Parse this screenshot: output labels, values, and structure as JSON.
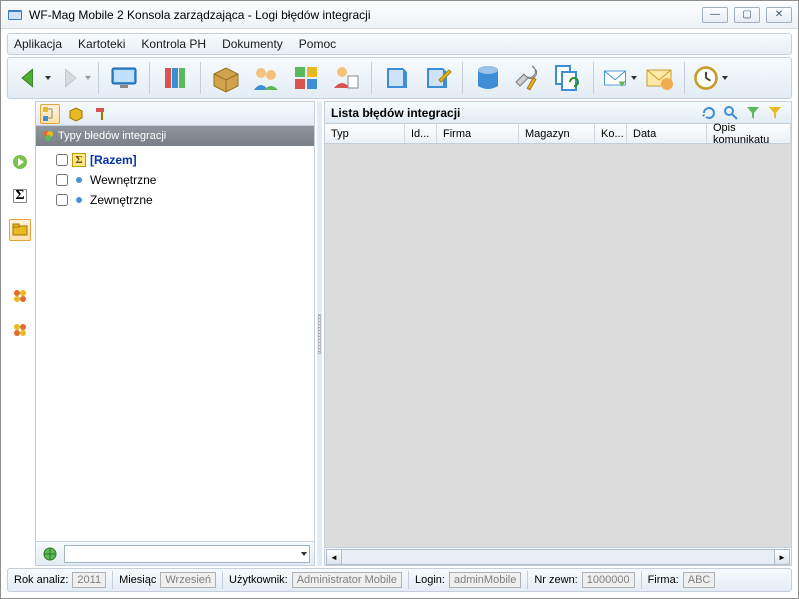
{
  "window": {
    "title": "WF-Mag Mobile 2 Konsola zarządzająca - Logi błędów integracji"
  },
  "menu": {
    "items": [
      "Aplikacja",
      "Kartoteki",
      "Kontrola PH",
      "Dokumenty",
      "Pomoc"
    ]
  },
  "tree": {
    "header": "Typy błedów integracji",
    "items": [
      {
        "label": "[Razem]",
        "kind": "sum",
        "bold": true
      },
      {
        "label": "Wewnętrzne",
        "kind": "bullet"
      },
      {
        "label": "Zewnętrzne",
        "kind": "bullet"
      }
    ]
  },
  "list": {
    "title": "Lista błędów integracji",
    "columns": [
      "Typ",
      "Id...",
      "Firma",
      "Magazyn",
      "Ko...",
      "Data",
      "Opis komunikatu"
    ]
  },
  "status": {
    "year_label": "Rok analiz:",
    "year_value": "2011",
    "month_label": "Miesiąc",
    "month_value": "Wrzesień",
    "user_label": "Użytkownik:",
    "user_value": "Administrator Mobile",
    "login_label": "Login:",
    "login_value": "adminMobile",
    "ext_label": "Nr zewn:",
    "ext_value": "1000000",
    "firm_label": "Firma:",
    "firm_value": "ABC"
  }
}
